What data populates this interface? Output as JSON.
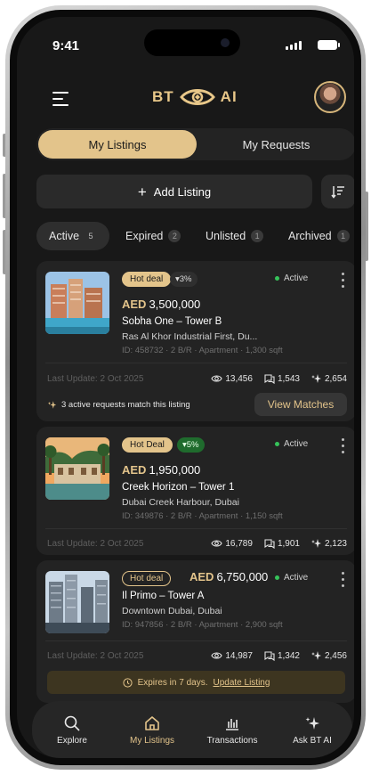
{
  "status_bar": {
    "time": "9:41"
  },
  "header": {
    "logo_left": "BT",
    "logo_right": "AI"
  },
  "segment": {
    "active": "My Listings",
    "inactive": "My Requests"
  },
  "add_listing": {
    "label": "Add Listing"
  },
  "filters": [
    {
      "label": "Active",
      "count": "5"
    },
    {
      "label": "Expired",
      "count": "2"
    },
    {
      "label": "Unlisted",
      "count": "1"
    },
    {
      "label": "Archived",
      "count": "1"
    }
  ],
  "listings": [
    {
      "badge": "Hot deal",
      "change": "▾3%",
      "status": "Active",
      "currency": "AED",
      "price": "3,500,000",
      "name": "Sobha One – Tower B",
      "location": "Ras Al Khor Industrial First, Du...",
      "meta": "ID: 458732 · 2 B/R · Apartment · 1,300 sqft",
      "updated": "Last Update: 2 Oct 2025",
      "views": "13,456",
      "requests": "1,543",
      "ai": "2,654",
      "match_text": "3 active requests match this listing",
      "match_button": "View Matches"
    },
    {
      "badge": "Hot Deal",
      "change": "▾5%",
      "status": "Active",
      "currency": "AED",
      "price": "1,950,000",
      "name": "Creek Horizon – Tower 1",
      "location": "Dubai Creek Harbour, Dubai",
      "meta": "ID: 349876 · 2 B/R · Apartment · 1,150 sqft",
      "updated": "Last Update: 2 Oct 2025",
      "views": "16,789",
      "requests": "1,901",
      "ai": "2,123"
    },
    {
      "badge": "Hot deal",
      "status": "Active",
      "currency": "AED",
      "price": "6,750,000",
      "name": "Il Primo – Tower A",
      "location": "Downtown Dubai, Dubai",
      "meta": "ID: 947856 · 2 B/R · Apartment · 2,900 sqft",
      "updated": "Last Update: 2 Oct 2025",
      "views": "14,987",
      "requests": "1,342",
      "ai": "2,456",
      "expire_text": "Expires in 7 days.",
      "expire_link": "Update Listing"
    }
  ],
  "nav": [
    {
      "label": "Explore",
      "icon": "search-icon"
    },
    {
      "label": "My Listings",
      "icon": "home-icon"
    },
    {
      "label": "Transactions",
      "icon": "chart-icon"
    },
    {
      "label": "Ask BT AI",
      "icon": "sparkle-icon"
    }
  ],
  "colors": {
    "accent": "#e3c48b",
    "background": "#181818",
    "card": "#232323",
    "active_dot": "#36c35a"
  }
}
